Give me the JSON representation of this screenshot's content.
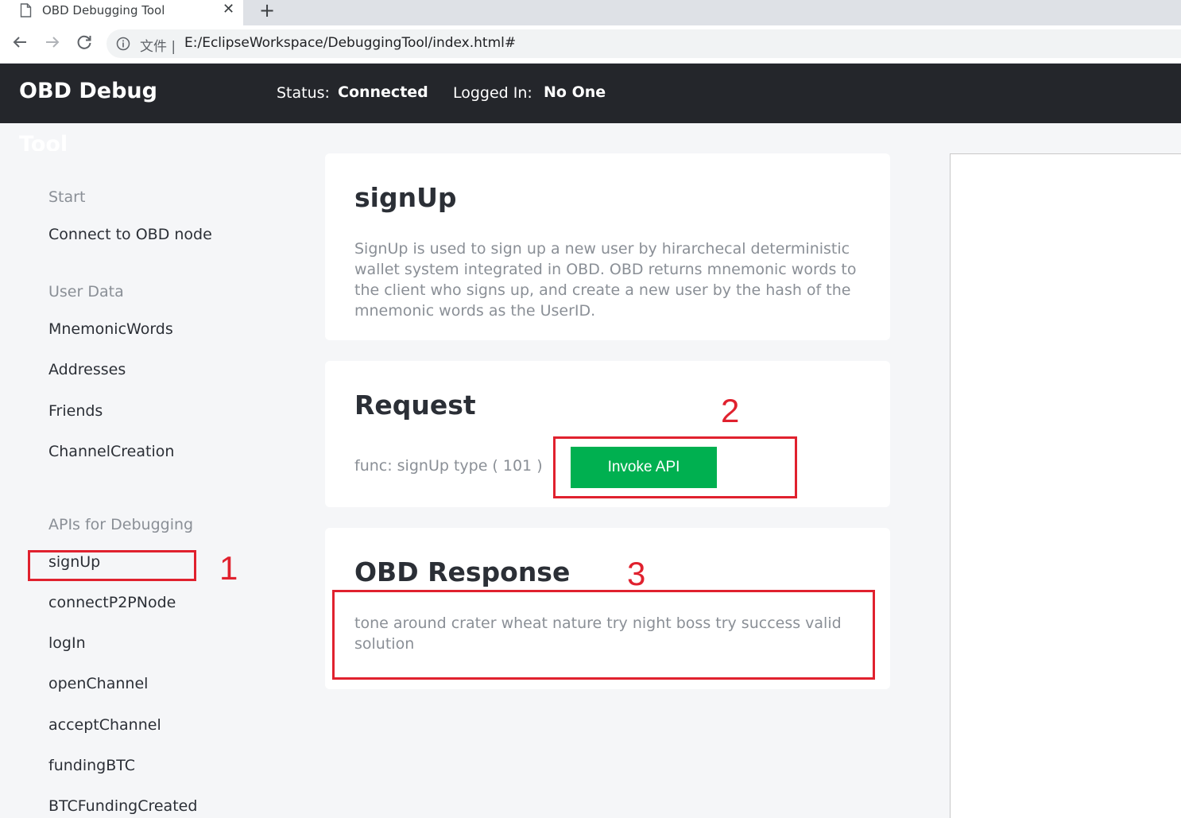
{
  "browser": {
    "tab_title": "OBD Debugging Tool",
    "close_glyph": "✕",
    "new_tab_glyph": "+",
    "url_label": "文件 |",
    "url": "E:/EclipseWorkspace/DebuggingTool/index.html#"
  },
  "header": {
    "brand": "OBD Debug",
    "brand_overflow": "Tool",
    "status_label": "Status:",
    "status_value": "Connected",
    "login_label": "Logged In:",
    "login_value": "No One"
  },
  "sidebar": {
    "start_heading": "Start",
    "start_items": [
      "Connect to OBD node"
    ],
    "user_heading": "User Data",
    "user_items": [
      "MnemonicWords",
      "Addresses",
      "Friends",
      "ChannelCreation"
    ],
    "api_heading": "APIs for Debugging",
    "api_items": [
      "signUp",
      "connectP2PNode",
      "logIn",
      "openChannel",
      "acceptChannel",
      "fundingBTC",
      "BTCFundingCreated"
    ]
  },
  "info_card": {
    "title": "signUp",
    "description": "SignUp is used to sign up a new user by hirarchecal deterministic wallet system integrated in OBD. OBD returns mnemonic words to the client who signs up, and create a new user by the hash of the mnemonic words as the UserID."
  },
  "request_card": {
    "title": "Request",
    "func_text": "func: signUp type ( 101 )",
    "invoke_label": "Invoke API"
  },
  "response_card": {
    "title": "OBD Response",
    "response_text": "tone around crater wheat nature try night boss try success valid solution"
  },
  "annotations": {
    "one": "1",
    "two": "2",
    "three": "3",
    "color": "#e0212e"
  },
  "colors": {
    "header_bg": "#24262b",
    "invoke_button": "#00b050",
    "page_bg": "#f5f6f8"
  }
}
